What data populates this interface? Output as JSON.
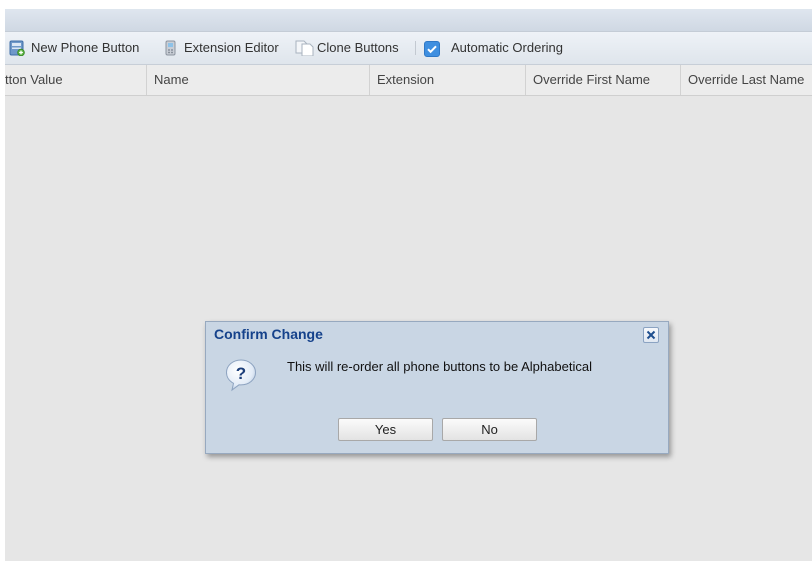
{
  "toolbar": {
    "new_phone_button": "New Phone Button",
    "extension_editor": "Extension Editor",
    "clone_buttons": "Clone Buttons",
    "automatic_ordering": "Automatic Ordering",
    "automatic_ordering_checked": true,
    "icons": [
      "new-phone-button-icon",
      "extension-editor-icon",
      "clone-buttons-icon",
      "checkbox-checked-icon"
    ]
  },
  "grid": {
    "columns": [
      "tton Value",
      "Name",
      "Extension",
      "Override First Name",
      "Override Last Name"
    ]
  },
  "dialog": {
    "title": "Confirm Change",
    "message": "This will re-order all phone buttons to be Alphabetical",
    "yes_label": "Yes",
    "no_label": "No",
    "icon": "question-icon",
    "close_icon": "close-icon"
  },
  "colors": {
    "dialog_title": "#15428b",
    "dialog_bg": "#c9d6e4",
    "checkbox": "#3f8fe0",
    "grid_bg": "#e6e6e6"
  }
}
